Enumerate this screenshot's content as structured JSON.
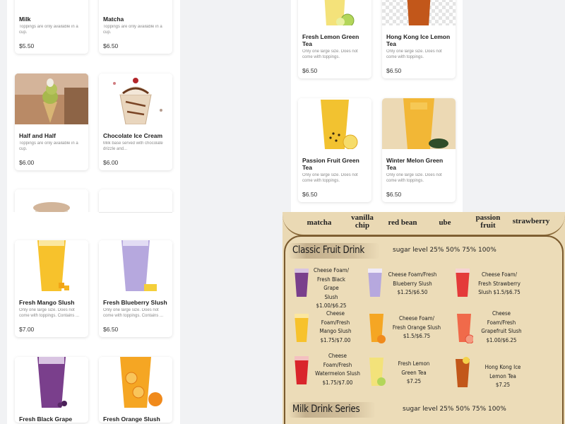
{
  "panel_top_left": {
    "cards": [
      {
        "name": "Milk",
        "desc": "Toppings are only available in a cup.",
        "price": "$5.50"
      },
      {
        "name": "Matcha",
        "desc": "Toppings are only available in a cup.",
        "price": "$6.50"
      },
      {
        "name": "Half and Half",
        "desc": "Toppings are only available in a cup.",
        "price": "$6.00"
      },
      {
        "name": "Chocolate Ice Cream",
        "desc": "Milk base served with chocolate drizzle and...",
        "price": "$6.00"
      }
    ]
  },
  "panel_top_right": {
    "cards": [
      {
        "name": "Fresh Lemon Green Tea",
        "desc": "Only one large size. Does not come with toppings.",
        "price": "$6.50"
      },
      {
        "name": "Hong Kong Ice Lemon Tea",
        "desc": "Only one large size. Does not come with toppings.",
        "price": "$6.50"
      },
      {
        "name": "Passion Fruit Green Tea",
        "desc": "Only one large size. Does not come with toppings.",
        "price": "$6.50"
      },
      {
        "name": "Winter Melon Green Tea",
        "desc": "Only one large size. Does not come with toppings.",
        "price": "$6.50"
      }
    ]
  },
  "panel_bottom_left": {
    "cards": [
      {
        "name": "Fresh Mango Slush",
        "desc": "Only one large size. Does not come with toppings. Contains ...",
        "price": "$7.00"
      },
      {
        "name": "Fresh Blueberry Slush",
        "desc": "Only one large size. Does not come with toppings. Contains ...",
        "price": "$6.50"
      },
      {
        "name": "Fresh Black Grape",
        "desc": "",
        "price": ""
      },
      {
        "name": "Fresh Orange Slush",
        "desc": "",
        "price": ""
      }
    ]
  },
  "menu_board": {
    "toppings": [
      "matcha",
      "vanilla chip",
      "red bean",
      "ube",
      "passion fruit",
      "strawberry"
    ],
    "classic_title": "Classic Fruit Drink",
    "classic_sugar": "sugar level 25% 50% 75% 100%",
    "classic_items": [
      {
        "lines": [
          "Cheese Foam/",
          "Fresh Black Grape",
          "Slush",
          "$1.00/$6.25"
        ]
      },
      {
        "lines": [
          "Cheese Foam/Fresh",
          "Blueberry Slush",
          "$1.25/$6.50"
        ]
      },
      {
        "lines": [
          "Cheese Foam/",
          "Fresh Strawberry",
          "Slush  $1.5/$6.75"
        ]
      },
      {
        "lines": [
          "Cheese",
          "Foam/Fresh",
          "Mango Slush",
          "$1.75/$7.00"
        ]
      },
      {
        "lines": [
          "Cheese Foam/",
          "Fresh Orange Slush",
          "$1.5/$6.75"
        ]
      },
      {
        "lines": [
          "Cheese",
          "Foam/Fresh",
          "Grapefruit Slush",
          "$1.00/$6.25"
        ]
      },
      {
        "lines": [
          "Cheese",
          "Foam/Fresh",
          "Watermelon Slush",
          "$1.75/$7.00"
        ]
      },
      {
        "lines": [
          "Fresh Lemon",
          "Green Tea",
          "$7.25"
        ]
      },
      {
        "lines": [
          "Hong Kong Ice",
          "Lemon Tea",
          "$7.25"
        ]
      }
    ],
    "milk_title": "Milk Drink Series",
    "milk_sugar": "sugar level 25% 50% 75% 100%"
  }
}
